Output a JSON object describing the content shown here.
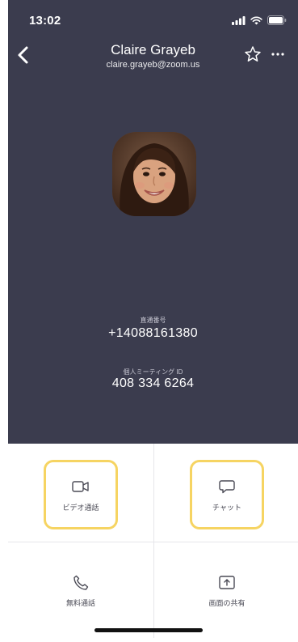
{
  "status_bar": {
    "time": "13:02",
    "icons": [
      "signal-icon",
      "wifi-icon",
      "battery-icon"
    ]
  },
  "header": {
    "name": "Claire Grayeb",
    "email": "claire.grayeb@zoom.us",
    "icons": [
      "back-chevron-icon",
      "star-icon",
      "more-icon"
    ]
  },
  "fields": {
    "direct_number_label": "直通番号",
    "direct_number": "+14088161380",
    "pmi_label": "個人ミーティング ID",
    "pmi": "408 334 6264"
  },
  "actions": {
    "video_call": "ビデオ通話",
    "chat": "チャット",
    "free_call": "無料通話",
    "share_screen": "画面の共有"
  },
  "colors": {
    "header_bg": "#3b3c4e",
    "highlight": "#f6d462",
    "text_secondary": "#4a4a55"
  }
}
